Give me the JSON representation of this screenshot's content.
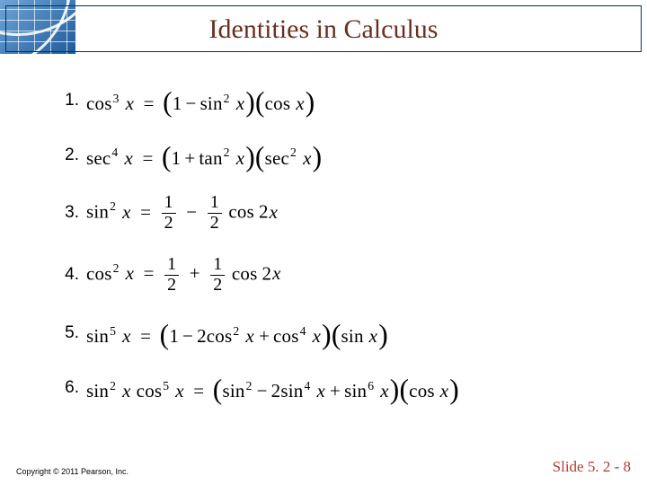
{
  "slide": {
    "title": "Identities in Calculus",
    "copyright": "Copyright © 2011 Pearson, Inc.",
    "slide_number": "Slide 5. 2 - 8"
  },
  "equations": {
    "e1_num": "1.",
    "e1_lhs_fn": "cos",
    "e1_lhs_pow": "3",
    "e1_a_fn": "sin",
    "e1_a_pow": "2",
    "e1_b_fn": "cos",
    "e2_num": "2.",
    "e2_lhs_fn": "sec",
    "e2_lhs_pow": "4",
    "e2_a_fn": "tan",
    "e2_a_pow": "2",
    "e2_b_fn": "sec",
    "e2_b_pow": "2",
    "e3_num": "3.",
    "e3_lhs_fn": "sin",
    "e3_lhs_pow": "2",
    "e3_fn": "cos",
    "e3_arg": "2",
    "e4_num": "4.",
    "e4_lhs_fn": "cos",
    "e4_lhs_pow": "2",
    "e4_fn": "cos",
    "e4_arg": "2",
    "e5_num": "5.",
    "e5_lhs_fn": "sin",
    "e5_lhs_pow": "5",
    "e5_a_fn": "cos",
    "e5_a_pow": "2",
    "e5_a_coef": "2",
    "e5_b_fn": "cos",
    "e5_b_pow": "4",
    "e5_c_fn": "sin",
    "e6_num": "6.",
    "e6_l1_fn": "sin",
    "e6_l1_pow": "2",
    "e6_l2_fn": "cos",
    "e6_l2_pow": "5",
    "e6_a_fn": "sin",
    "e6_a_pow": "2",
    "e6_b_fn": "sin",
    "e6_b_pow": "4",
    "e6_b_coef": "2",
    "e6_c_fn": "sin",
    "e6_c_pow": "6",
    "e6_d_fn": "cos"
  },
  "symbols": {
    "x": "x",
    "one": "1",
    "two": "2",
    "eq": "=",
    "minus": "−",
    "plus": "+",
    "lp": "(",
    "rp": ")"
  }
}
